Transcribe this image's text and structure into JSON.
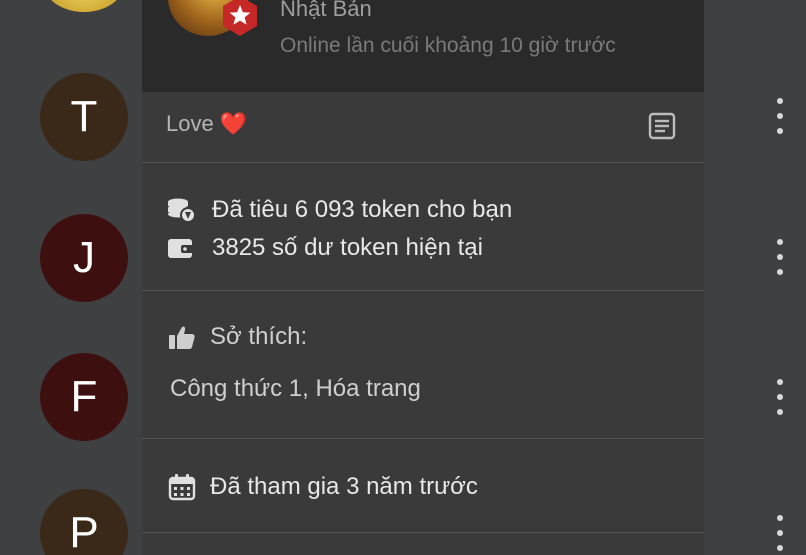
{
  "profile": {
    "country": "Nhật Bản",
    "last_online": "Online lần cuối khoảng 10 giờ trước",
    "status": "Love ❤️"
  },
  "tokens": {
    "spent": "Đã tiêu 6 093 token cho bạn",
    "balance": "3825 số dư token hiện tại"
  },
  "hobbies": {
    "title": "Sở thích:",
    "list": "Công thức 1, Hóa trang"
  },
  "joined": "Đã tham gia 3 năm trước",
  "list": {
    "avatars": [
      {
        "initial": "T",
        "color": "#3a2818"
      },
      {
        "initial": "J",
        "color": "#3e0f0f"
      },
      {
        "initial": "F",
        "color": "#3e0f0f"
      },
      {
        "initial": "P",
        "color": "#3a2818"
      }
    ]
  },
  "icons": {
    "badge": "star-badge-icon",
    "notes": "notes-icon",
    "tokens": "coins-icon",
    "wallet": "wallet-icon",
    "like": "thumbs-up-icon",
    "calendar": "calendar-icon",
    "more": "more-vertical-icon"
  },
  "colors": {
    "badge": "#c62828",
    "panel": "#3a3a3a",
    "header": "#2a2a2a",
    "page": "#3f4042"
  }
}
